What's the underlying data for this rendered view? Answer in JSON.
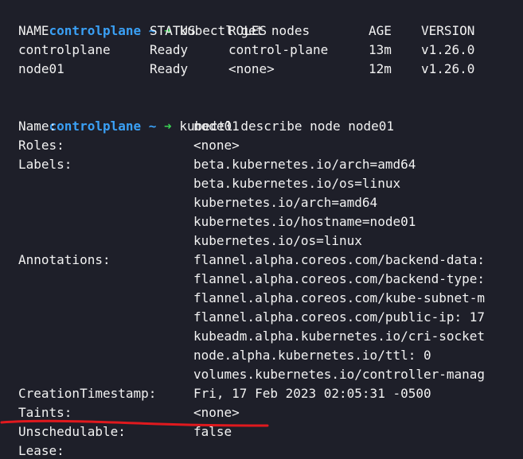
{
  "colors": {
    "background": "#1e1f29",
    "prompt": "#3aa0f5",
    "arrow": "#39d353",
    "text": "#f2f2f2",
    "annotation": "#e0191e"
  },
  "prompt1": {
    "host": "controlplane",
    "tilde": "~",
    "arrow": "➜",
    "command": "kubectl get nodes"
  },
  "nodes_table": {
    "headers": [
      "NAME",
      "STATUS",
      "ROLES",
      "AGE",
      "VERSION"
    ],
    "rows": [
      [
        "controlplane",
        "Ready",
        "control-plane",
        "13m",
        "v1.26.0"
      ],
      [
        "node01",
        "Ready",
        "<none>",
        "12m",
        "v1.26.0"
      ]
    ]
  },
  "prompt2": {
    "host": "controlplane",
    "tilde": "~",
    "arrow": "➜",
    "command": "kubectl describe node node01"
  },
  "describe": {
    "name_key": "Name:",
    "name_val": "node01",
    "roles_key": "Roles:",
    "roles_val": "<none>",
    "labels_key": "Labels:",
    "labels": [
      "beta.kubernetes.io/arch=amd64",
      "beta.kubernetes.io/os=linux",
      "kubernetes.io/arch=amd64",
      "kubernetes.io/hostname=node01",
      "kubernetes.io/os=linux"
    ],
    "annotations_key": "Annotations:",
    "annotations": [
      "flannel.alpha.coreos.com/backend-data:",
      "flannel.alpha.coreos.com/backend-type:",
      "flannel.alpha.coreos.com/kube-subnet-m",
      "flannel.alpha.coreos.com/public-ip: 17",
      "kubeadm.alpha.kubernetes.io/cri-socket",
      "node.alpha.kubernetes.io/ttl: 0",
      "volumes.kubernetes.io/controller-manag"
    ],
    "creation_key": "CreationTimestamp:",
    "creation_val": "Fri, 17 Feb 2023 02:05:31 -0500",
    "taints_key": "Taints:",
    "taints_val": "<none>",
    "unschedulable_key": "Unschedulable:",
    "unschedulable_val": "false",
    "lease_key": "Lease:"
  }
}
